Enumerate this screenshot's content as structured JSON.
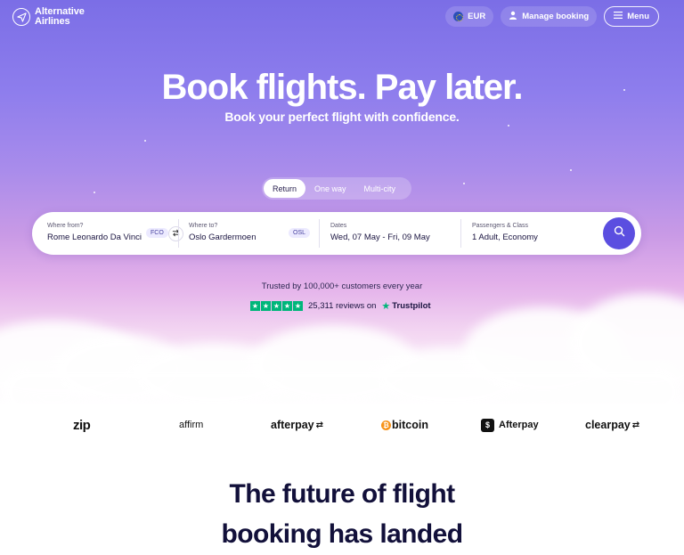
{
  "brand": {
    "name_line1": "Alternative",
    "name_line2": "Airlines"
  },
  "nav": {
    "currency": "EUR",
    "manage_booking": "Manage booking",
    "menu": "Menu"
  },
  "hero": {
    "title": "Book flights. Pay later.",
    "subtitle": "Book your perfect flight with confidence."
  },
  "trip_types": [
    "Return",
    "One way",
    "Multi-city"
  ],
  "search": {
    "from": {
      "label": "Where from?",
      "value": "Rome Leonardo Da Vinci",
      "code": "FCO"
    },
    "to": {
      "label": "Where to?",
      "value": "Oslo Gardermoen",
      "code": "OSL"
    },
    "dates": {
      "label": "Dates",
      "value": "Wed, 07 May - Fri, 09 May"
    },
    "passengers": {
      "label": "Passengers & Class",
      "value": "1 Adult, Economy"
    }
  },
  "trust": {
    "text": "Trusted by 100,000+ customers every year",
    "reviews": "25,311 reviews on",
    "brand": "Trustpilot",
    "stars": 5
  },
  "partners": [
    "zip",
    "affirm",
    "afterpay",
    "bitcoin",
    "Afterpay",
    "clearpay"
  ],
  "section": {
    "line1": "The future of flight",
    "line2": "booking has landed"
  },
  "colors": {
    "accent": "#5b4ee0",
    "trustpilot": "#00b67a"
  }
}
